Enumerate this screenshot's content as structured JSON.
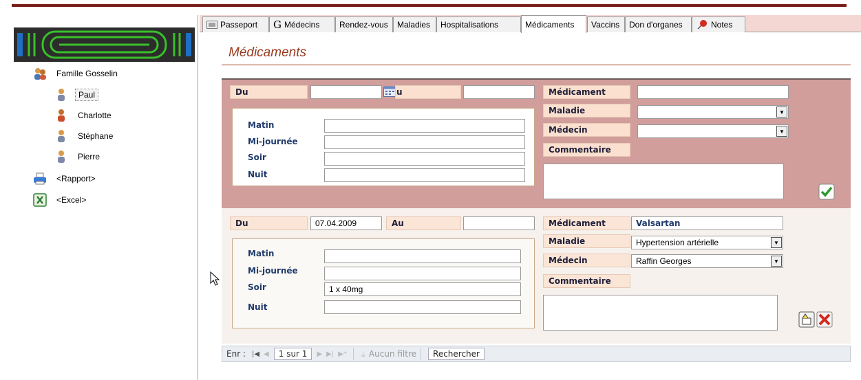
{
  "tabs": [
    {
      "label": "Passeport",
      "icon": "list-icon"
    },
    {
      "label": "Médecins",
      "icon": "g-icon"
    },
    {
      "label": "Rendez-vous"
    },
    {
      "label": "Maladies"
    },
    {
      "label": "Hospitalisations"
    },
    {
      "label": "Médicaments",
      "active": true
    },
    {
      "label": "Vaccins"
    },
    {
      "label": "Don d'organes"
    },
    {
      "label": "Notes",
      "icon": "pushpin-icon"
    }
  ],
  "sidebar": {
    "family": "Famille Gosselin",
    "members": [
      "Paul",
      "Charlotte",
      "Stéphane",
      "Pierre"
    ],
    "selected": "Paul",
    "report": "<Rapport>",
    "excel": "<Excel>"
  },
  "title": "Médicaments",
  "labels": {
    "du": "Du",
    "au": "Au",
    "au_partial": "u",
    "medicament": "Médicament",
    "maladie": "Maladie",
    "medecin": "Médecin",
    "commentaire": "Commentaire",
    "matin": "Matin",
    "mijournee": "Mi-journée",
    "soir": "Soir",
    "nuit": "Nuit"
  },
  "record": {
    "du": "07.04.2009",
    "au": "",
    "medicament": "Valsartan",
    "maladie": "Hypertension artérielle",
    "medecin": "Raffin Georges",
    "matin": "",
    "mijournee": "",
    "soir": "1 x 40mg",
    "nuit": "",
    "commentaire": ""
  },
  "navbar": {
    "prefix": "Enr :",
    "current": "1 sur 1",
    "filter": "Aucun filtre",
    "search": "Rechercher"
  },
  "colors": {
    "new_panel": "#d19e9c",
    "record_panel": "#f6f1ec",
    "title": "#9a3a1e",
    "topbar": "#7a1f1a"
  }
}
